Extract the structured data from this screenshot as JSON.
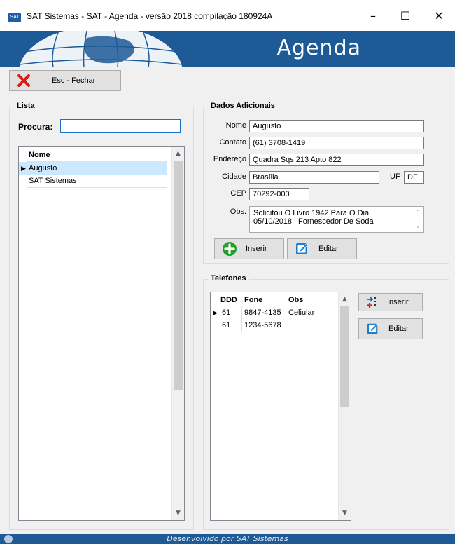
{
  "window": {
    "title": "SAT Sistemas - SAT - Agenda - versão 2018 compilação 180924A",
    "app_icon": "SAT",
    "minimize": "–",
    "maximize": "☐",
    "close": "✕"
  },
  "banner": {
    "title": "Agenda"
  },
  "toolbar": {
    "close_label": "Esc - Fechar",
    "close_icon": "red-x-icon"
  },
  "lista": {
    "title": "Lista",
    "search_label": "Procura:",
    "search_value": "",
    "columns": [
      "Nome"
    ],
    "rows": [
      "Augusto",
      "SAT Sistemas"
    ],
    "selected_index": 0
  },
  "dados": {
    "title": "Dados Adicionais",
    "nome_label": "Nome",
    "nome": "Augusto",
    "contato_label": "Contato",
    "contato": "(61) 3708-1419",
    "endereco_label": "Endereço",
    "endereco": "Quadra Sqs 213 Apto 822",
    "cidade_label": "Cidade",
    "cidade": "Brasília",
    "uf_label": "UF",
    "uf": "DF",
    "cep_label": "CEP",
    "cep": "70292-000",
    "obs_label": "Obs.",
    "obs_line1": "Solicitou O Livro 1942 Para O Dia",
    "obs_line2": "05/10/2018 | Fornescedor De Soda",
    "inserir_label": "Inserir",
    "editar_label": "Editar"
  },
  "telefones": {
    "title": "Telefones",
    "columns": [
      "DDD",
      "Fone",
      "Obs"
    ],
    "rows": [
      {
        "ddd": "61",
        "fone": "9847-4135",
        "obs": "Celiular"
      },
      {
        "ddd": "61",
        "fone": "1234-5678",
        "obs": ""
      }
    ],
    "inserir_label": "Inserir",
    "editar_label": "Editar"
  },
  "status": {
    "text": "Desenvolvido por SAT Sistemas"
  },
  "colors": {
    "brand_blue": "#1d5a96",
    "selection": "#cce8ff",
    "add_green": "#1fa02a",
    "edit_blue": "#1a7fd0",
    "close_red": "#d81b1b"
  }
}
